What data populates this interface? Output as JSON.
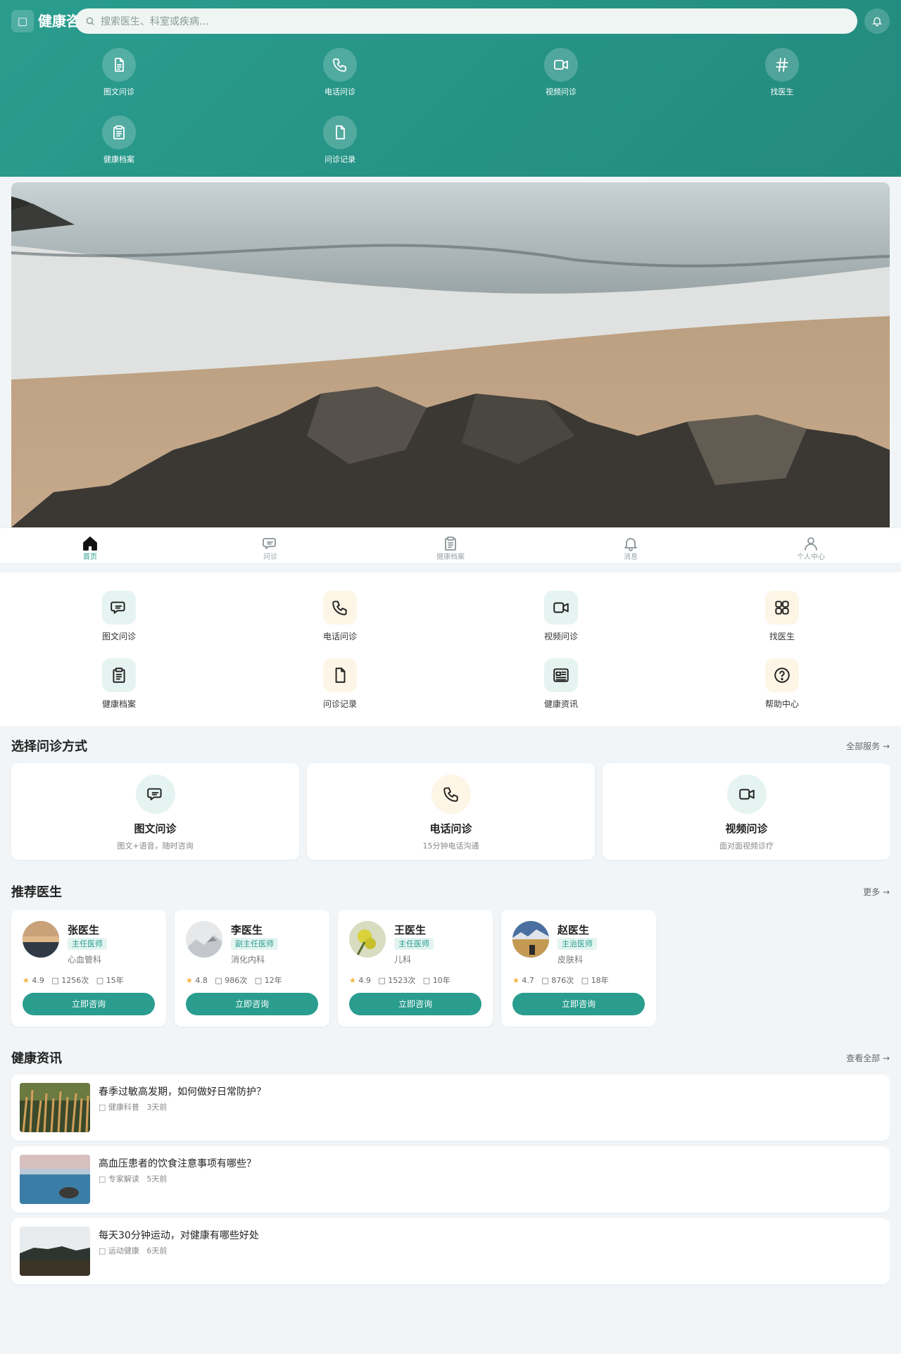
{
  "header": {
    "menu_icon": "□",
    "title": "健康咨询",
    "search_placeholder": "搜索医生、科室或疾病...",
    "items": [
      {
        "icon": "document-icon",
        "label": "图文问诊"
      },
      {
        "icon": "phone-icon",
        "label": "电话问诊"
      },
      {
        "icon": "video-icon",
        "label": "视频问诊"
      },
      {
        "icon": "hash-icon",
        "label": "找医生"
      },
      {
        "icon": "clipboard-icon",
        "label": "健康档案"
      },
      {
        "icon": "file-icon",
        "label": "问诊记录"
      }
    ]
  },
  "tabbar": [
    {
      "icon": "home-icon",
      "label": "首页",
      "active": true
    },
    {
      "icon": "chat-icon",
      "label": "问诊",
      "active": false
    },
    {
      "icon": "clipboard-icon",
      "label": "健康档案",
      "active": false
    },
    {
      "icon": "bell-icon",
      "label": "消息",
      "active": false
    },
    {
      "icon": "user-icon",
      "label": "个人中心",
      "active": false
    }
  ],
  "quick": [
    {
      "icon": "chat-icon",
      "label": "图文问诊",
      "bg": "#e6f4f1"
    },
    {
      "icon": "phone-icon",
      "label": "电话问诊",
      "bg": "#fdf5e6"
    },
    {
      "icon": "video-icon",
      "label": "视频问诊",
      "bg": "#e6f4f1"
    },
    {
      "icon": "grid-icon",
      "label": "找医生",
      "bg": "#fdf5e6"
    },
    {
      "icon": "clipboard-icon",
      "label": "健康档案",
      "bg": "#e6f4f1"
    },
    {
      "icon": "file-icon",
      "label": "问诊记录",
      "bg": "#fdf5e6"
    },
    {
      "icon": "news-icon",
      "label": "健康资讯",
      "bg": "#e6f4f1"
    },
    {
      "icon": "help-icon",
      "label": "帮助中心",
      "bg": "#fdf5e6"
    }
  ],
  "consult": {
    "title": "选择问诊方式",
    "more": "全部服务 →",
    "cards": [
      {
        "icon": "chat-icon",
        "title": "图文问诊",
        "sub": "图文+语音，随时咨询",
        "bg": "#e6f4f1"
      },
      {
        "icon": "phone-icon",
        "title": "电话问诊",
        "sub": "15分钟电话沟通",
        "bg": "#fdf5e6"
      },
      {
        "icon": "video-icon",
        "title": "视频问诊",
        "sub": "面对面视频诊疗",
        "bg": "#e6f4f1"
      }
    ]
  },
  "doctors": {
    "title": "推荐医生",
    "more": "更多 →",
    "list": [
      {
        "name": "张医生",
        "badge": "主任医师",
        "dept": "心血管科",
        "rating": "4.9",
        "consults": "1256次",
        "years": "15年",
        "button": "立即咨询",
        "avatar": "sunset"
      },
      {
        "name": "李医生",
        "badge": "副主任医师",
        "dept": "消化内科",
        "rating": "4.8",
        "consults": "986次",
        "years": "12年",
        "button": "立即咨询",
        "avatar": "mist"
      },
      {
        "name": "王医生",
        "badge": "主任医师",
        "dept": "儿科",
        "rating": "4.9",
        "consults": "1523次",
        "years": "10年",
        "button": "立即咨询",
        "avatar": "flower"
      },
      {
        "name": "赵医生",
        "badge": "主治医师",
        "dept": "皮肤科",
        "rating": "4.7",
        "consults": "876次",
        "years": "18年",
        "button": "立即咨询",
        "avatar": "field"
      }
    ]
  },
  "articles": {
    "title": "健康资讯",
    "more": "查看全部 →",
    "list": [
      {
        "title": "春季过敏高发期，如何做好日常防护？",
        "source": "健康科普",
        "time": "3天前",
        "thumb": "grass"
      },
      {
        "title": "高血压患者的饮食注意事项有哪些？",
        "source": "专家解读",
        "time": "5天前",
        "thumb": "sea"
      },
      {
        "title": "每天30分钟运动，对健康有哪些好处",
        "source": "运动健康",
        "time": "6天前",
        "thumb": "hill"
      }
    ]
  },
  "colors": {
    "primary": "#2a9d8f",
    "accent_warm": "#fdf5e6",
    "accent_cool": "#e6f4f1"
  }
}
